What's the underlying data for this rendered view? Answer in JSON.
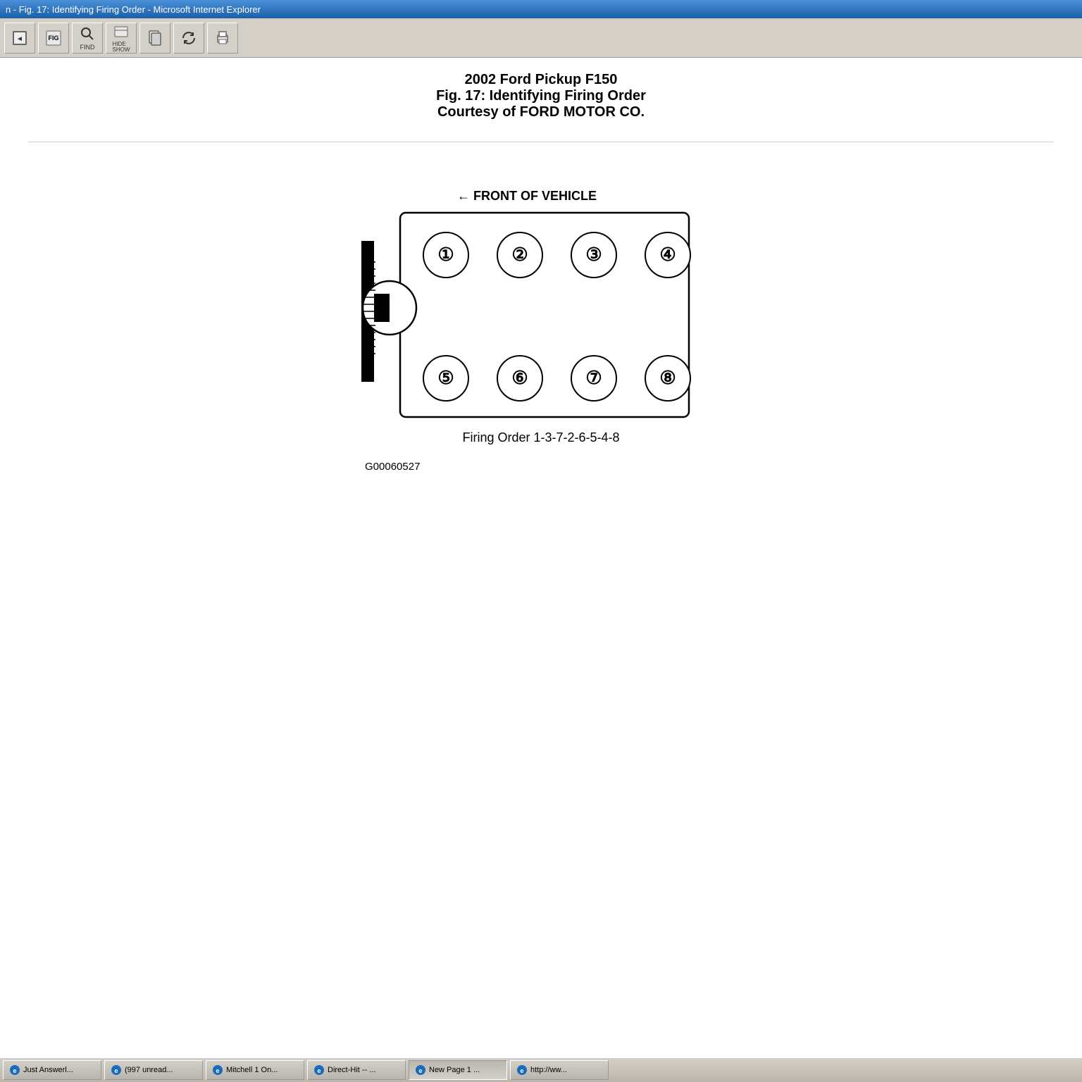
{
  "titleBar": {
    "text": "n - Fig. 17: Identifying Firing Order - Microsoft Internet Explorer"
  },
  "toolbar": {
    "buttons": [
      {
        "name": "prev-fig",
        "label": ""
      },
      {
        "name": "fig",
        "label": "FIG"
      },
      {
        "name": "find",
        "label": "FIND"
      },
      {
        "name": "hide-show",
        "label": "HIDE\nSHOW"
      },
      {
        "name": "print",
        "label": ""
      },
      {
        "name": "refresh",
        "label": ""
      },
      {
        "name": "print2",
        "label": ""
      }
    ]
  },
  "pageHeader": {
    "vehicleTitle": "2002 Ford Pickup F150",
    "figTitle": "Fig. 17: Identifying Firing Order",
    "courtesy": "Courtesy of FORD MOTOR CO."
  },
  "diagram": {
    "frontLabel": "FRONT OF VEHICLE",
    "firingOrder": "Firing Order 1-3-7-2-6-5-4-8",
    "partNumber": "G00060527",
    "cylinders": {
      "top": [
        "①",
        "②",
        "③",
        "④"
      ],
      "bottom": [
        "⑤",
        "⑥",
        "⑦",
        "⑧"
      ]
    }
  },
  "taskbar": {
    "items": [
      {
        "label": "Just Answerl...",
        "active": false
      },
      {
        "label": "(997 unread...",
        "active": false
      },
      {
        "label": "Mitchell 1 On...",
        "active": false
      },
      {
        "label": "Direct-Hit -- ...",
        "active": false
      },
      {
        "label": "New Page 1 ...",
        "active": true
      },
      {
        "label": "http://ww...",
        "active": false
      }
    ]
  }
}
